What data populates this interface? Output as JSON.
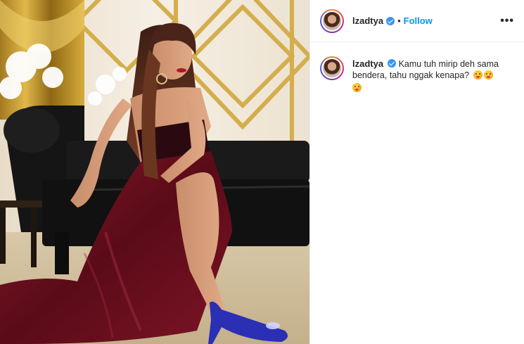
{
  "header": {
    "username": "lzadtya",
    "separator": "•",
    "follow_label": "Follow",
    "more_label": "•••"
  },
  "caption": {
    "username": "lzadtya",
    "text": "Kamu tuh mirip deh sama bendera, tahu nggak kenapa?",
    "emojis": [
      "grinning-tongue-emoji",
      "grinning-tongue-emoji",
      "grinning-tongue-emoji"
    ]
  },
  "photo": {
    "description_icon": "photo"
  },
  "colors": {
    "follow": "#0095f6",
    "verified": "#3897f0",
    "dress": "#6e0f1f",
    "shoe": "#2a2fb5"
  }
}
